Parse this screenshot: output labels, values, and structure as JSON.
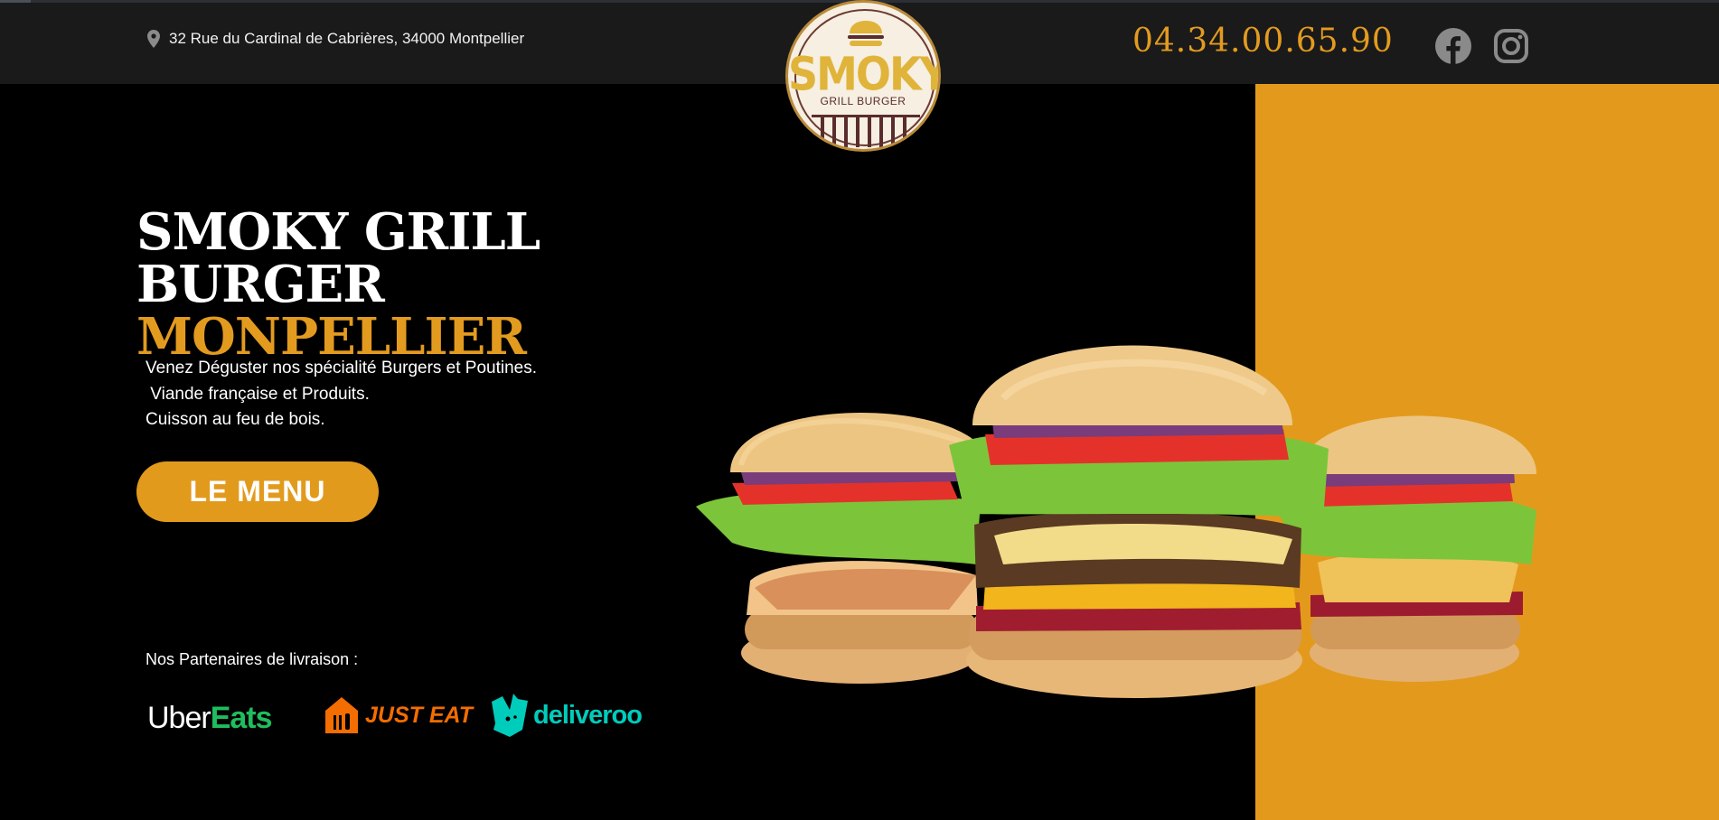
{
  "header": {
    "address": "32 Rue du Cardinal de Cabrières, 34000 Montpellier",
    "phone": "04.34.00.65.90",
    "social": [
      "facebook-icon",
      "instagram-icon"
    ]
  },
  "logo": {
    "wordmark": "SMOKY",
    "subtitle": "GRILL BURGER"
  },
  "hero": {
    "title_line1": "SMOKY GRILL",
    "title_line2": "BURGER",
    "title_accent": "MONPELLIER",
    "tagline": "Venez Déguster nos spécialité Burgers et Poutines.\n Viande française et Produits.\nCuisson au feu de bois.",
    "menu_button": "LE MENU",
    "image": "three-burgers-image"
  },
  "partners": {
    "label": "Nos Partenaires de livraison :",
    "uber_part1": "Uber",
    "uber_part2": "Eats",
    "justeat": "JUST EAT",
    "deliveroo": "deliveroo"
  },
  "colors": {
    "accent": "#e39b1f",
    "header_bg": "#1a1a1a",
    "uber_green": "#1fbd5e",
    "justeat_orange": "#f36d00",
    "deliveroo_teal": "#00ccbc"
  }
}
